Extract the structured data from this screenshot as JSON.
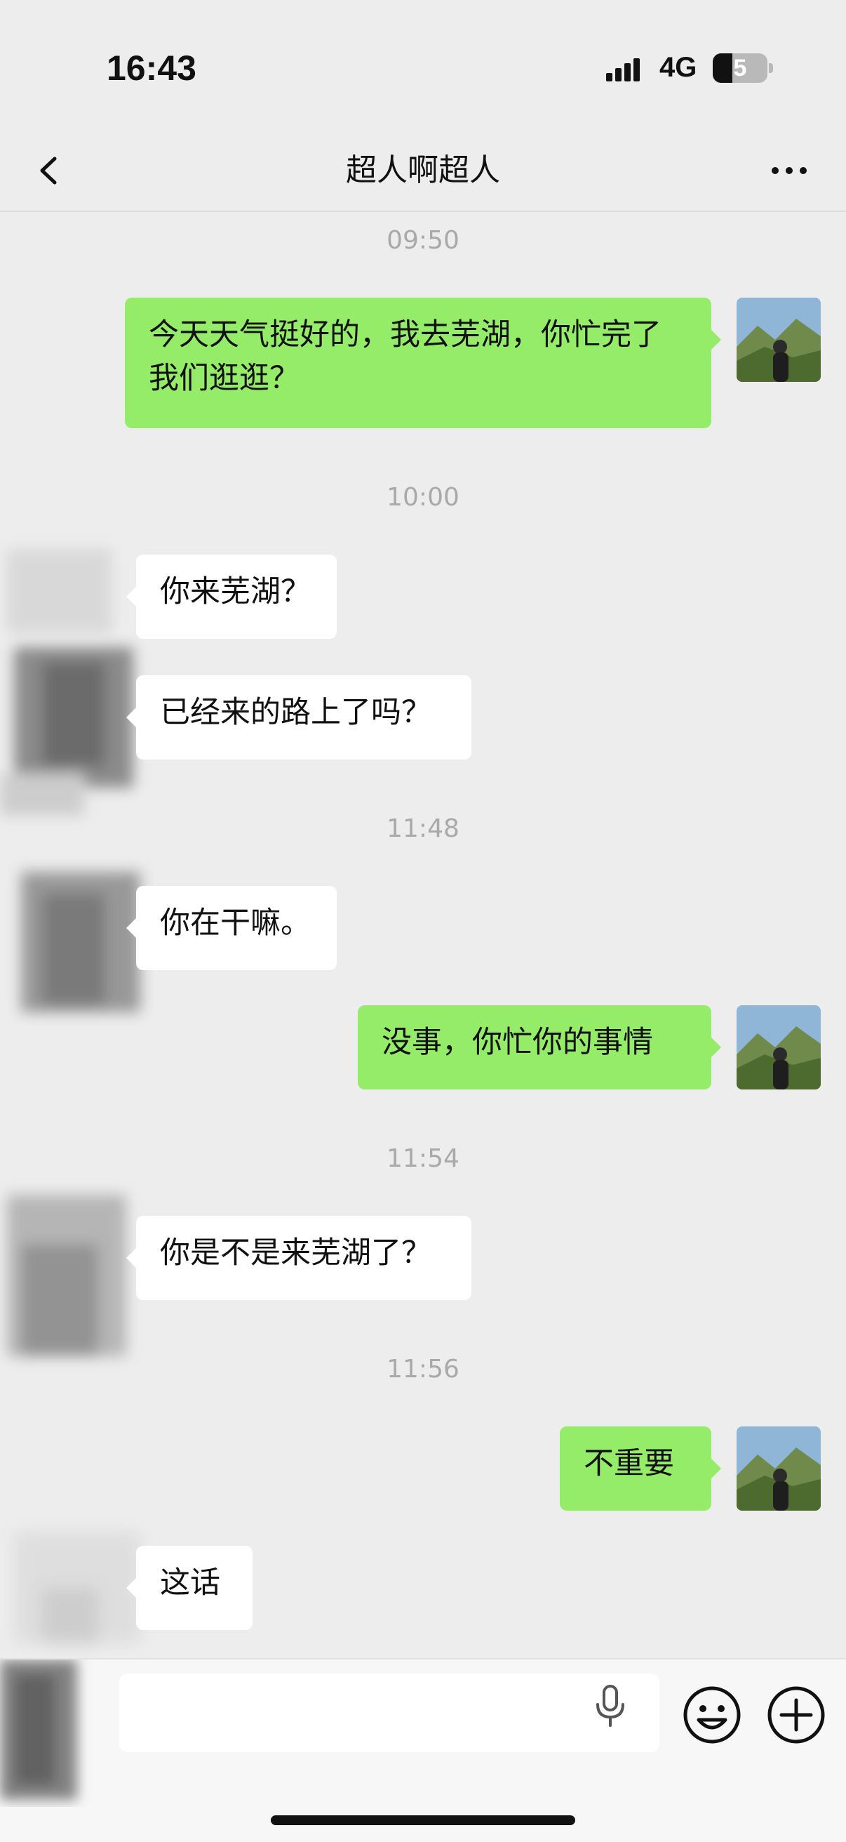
{
  "status": {
    "time": "16:43",
    "network": "4G",
    "battery": "5"
  },
  "header": {
    "title": "超人啊超人"
  },
  "messages": [
    {
      "kind": "timestamp",
      "text": "09:50"
    },
    {
      "kind": "me",
      "text": "今天天气挺好的，我去芜湖，你忙完了我们逛逛？"
    },
    {
      "kind": "timestamp",
      "text": "10:00"
    },
    {
      "kind": "them",
      "text": "你来芜湖？"
    },
    {
      "kind": "them",
      "text": "已经来的路上了吗？"
    },
    {
      "kind": "timestamp",
      "text": "11:48"
    },
    {
      "kind": "them",
      "text": "你在干嘛。"
    },
    {
      "kind": "me",
      "text": "没事，你忙你的事情"
    },
    {
      "kind": "timestamp",
      "text": "11:54"
    },
    {
      "kind": "them",
      "text": "你是不是来芜湖了？"
    },
    {
      "kind": "timestamp",
      "text": "11:56"
    },
    {
      "kind": "me",
      "text": "不重要"
    },
    {
      "kind": "them",
      "text": "这话"
    }
  ],
  "colors": {
    "me_bubble": "#95ec69",
    "them_bubble": "#ffffff",
    "background": "#ededed"
  }
}
